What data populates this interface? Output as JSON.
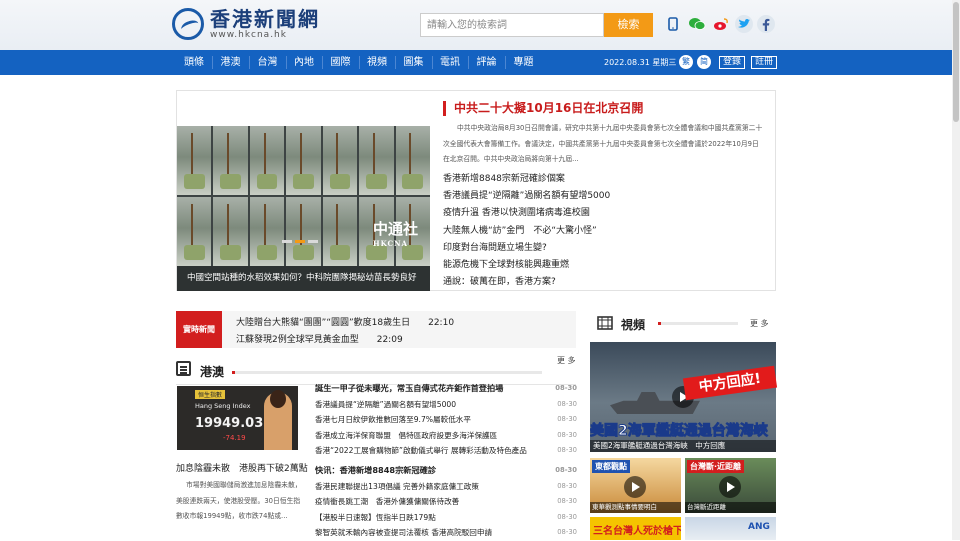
{
  "header": {
    "logo_cn": "香港新聞網",
    "logo_url": "www.hkcna.hk",
    "search_placeholder": "請輸入您的檢索詞",
    "search_button": "檢索",
    "social_icons": [
      "mobile-icon",
      "wechat-icon",
      "weibo-icon",
      "twitter-icon",
      "facebook-icon"
    ]
  },
  "nav": {
    "items": [
      "頭條",
      "港澳",
      "台灣",
      "內地",
      "國際",
      "視頻",
      "圖集",
      "電訊",
      "評論",
      "專題"
    ],
    "date": "2022.08.31 星期三",
    "lang_trad": "繁",
    "lang_simp": "简",
    "login": "登錄",
    "register": "註冊"
  },
  "top": {
    "slider_caption": "中國空間站種的水稻效果如何？中科院團隊揭秘幼苗長勢良好",
    "slider_logo_cn": "中通社",
    "slider_logo_en": "HKCNA",
    "headline": "中共二十大擬10月16日在北京召開",
    "summary": "中共中央政治局8月30日召開會議，研究中共第十九屆中央委員會第七次全體會議和中國共產黨第二十次全國代表大會籌備工作。會議決定，中國共產黨第十九屆中央委員會第七次全體會議於2022年10月9日在北京召開。中共中央政治局將向第十九屆...",
    "list": [
      "香港新增8848宗新冠確診個案",
      "香港議員提“逆隔離”過關名額有望增5000",
      "疫情升溫 香港以快測圍堵病毒進校園",
      "大陸無人機“訪”金門　不必“大驚小怪”",
      "印度對台海問題立場生變?",
      "能源危機下全球對核能興趣重燃",
      "通說：破萬在即，香港方案?"
    ]
  },
  "live": {
    "tag": "實時新聞",
    "items": [
      {
        "text": "大陸贈台大熊貓“團團”“圓圓”歡度18歲生日",
        "time": "22:10"
      },
      {
        "text": "江蘇發現2例全球罕見黃金血型",
        "time": "22:09"
      }
    ]
  },
  "hk": {
    "title": "港澳",
    "more": "更 多",
    "hsi_tag": "恒生指數",
    "hsi_en": "Hang Seng Index",
    "hsi_value": "19949.03",
    "hsi_change": "-74.19",
    "feature_title": "加息陰霾未散　港股再下破2萬點",
    "feature_body": "市場對美國聯儲局激進加息陰霾未散，美股連跌兩天，使港股受壓。30日恒生指數收市報19949點，收市跌74點或...",
    "list": [
      {
        "text": "誕生一甲子從未曝光，常玉自傳式花卉鉅作首登拍場",
        "date": "08-30",
        "bold": true
      },
      {
        "text": "香港議員提“逆隔離”過關名額有望增5000",
        "date": "08-30"
      },
      {
        "text": "香港七月日紋伊飲推數回落至9.7%屬較低水平",
        "date": "08-30"
      },
      {
        "text": "香港成立海洋保育聯盟　倡特區政府設更多海洋保護區",
        "date": "08-30"
      },
      {
        "text": "香港“2022工展會購物節”啟動儀式舉行 展轉彩活動及特色產品",
        "date": "08-30"
      },
      {
        "text": "快讯：香港新增8848宗新冠確診",
        "date": "08-30",
        "bold": true
      },
      {
        "text": "香港民建聯提出13項倡議 完善外籍家庭傭工政策",
        "date": "08-30"
      },
      {
        "text": "疫情衝長跳工潮　香港外傭獲傭關係待改善",
        "date": "08-30"
      },
      {
        "text": "【港股半日速報】恆指半日跌179點",
        "date": "08-30"
      },
      {
        "text": "黎智英就禾輸內容被查提司法覆核 香港高院駁回申請",
        "date": "08-30"
      }
    ]
  },
  "video": {
    "title": "視頻",
    "more": "更 多",
    "main_overlay": "中方回应!",
    "main_big": "美國2海軍艦艇通過台灣海峽",
    "main_caption": "美國2海軍艦艇通過台灣海峽　中方回應",
    "thumb1_label": "東都觀點",
    "thumb1_caption": "東華觀測點事情要明白",
    "thumb2_label": "台灣斷·近距離",
    "thumb2_caption": "台灣斷近距離",
    "thumb3_label": "三名台灣人死於槍下",
    "thumb4_label": "ANG"
  }
}
